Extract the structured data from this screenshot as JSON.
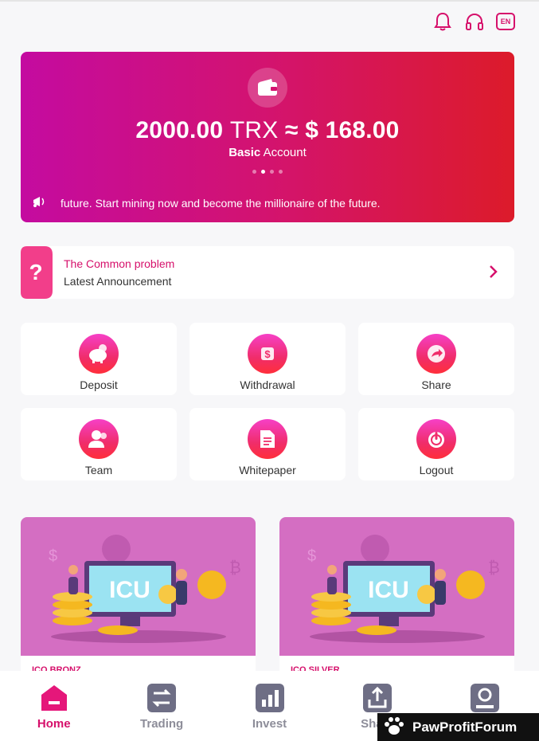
{
  "header": {
    "language_label": "EN",
    "icons": [
      "bell-icon",
      "headset-icon"
    ]
  },
  "banner": {
    "balance_amount": "2000.00",
    "balance_unit": "TRX",
    "approx": "≈",
    "usd_value": "$ 168.00",
    "account_level": "Basic",
    "account_suffix": "Account",
    "marquee_text": "future. Start mining now and become the millionaire of the future.",
    "slide_count": 4,
    "active_slide": 1
  },
  "announcement": {
    "title": "The Common problem",
    "subtitle": "Latest Announcement"
  },
  "actions": [
    {
      "label": "Deposit",
      "icon": "piggy-bank-icon"
    },
    {
      "label": "Withdrawal",
      "icon": "dollar-coin-icon"
    },
    {
      "label": "Share",
      "icon": "share-arrow-icon"
    },
    {
      "label": "Team",
      "icon": "users-icon"
    },
    {
      "label": "Whitepaper",
      "icon": "document-icon"
    },
    {
      "label": "Logout",
      "icon": "power-icon"
    }
  ],
  "cards": [
    {
      "art_text": "ICU",
      "subtitle": "ICO BRONZ"
    },
    {
      "art_text": "ICU",
      "subtitle": "ICO SILVER"
    }
  ],
  "tabs": [
    {
      "label": "Home",
      "icon": "home-icon",
      "active": true
    },
    {
      "label": "Trading",
      "icon": "exchange-icon",
      "active": false
    },
    {
      "label": "Invest",
      "icon": "bar-chart-icon",
      "active": false
    },
    {
      "label": "Share",
      "icon": "upload-icon",
      "active": false
    },
    {
      "label": "",
      "icon": "profile-icon",
      "active": false
    }
  ],
  "watermark": "PawProfitForum",
  "colors": {
    "accent": "#d6106b",
    "banner_start": "#c40ba0",
    "banner_end": "#dc1b2a",
    "tab_inactive": "#8d8d99"
  }
}
